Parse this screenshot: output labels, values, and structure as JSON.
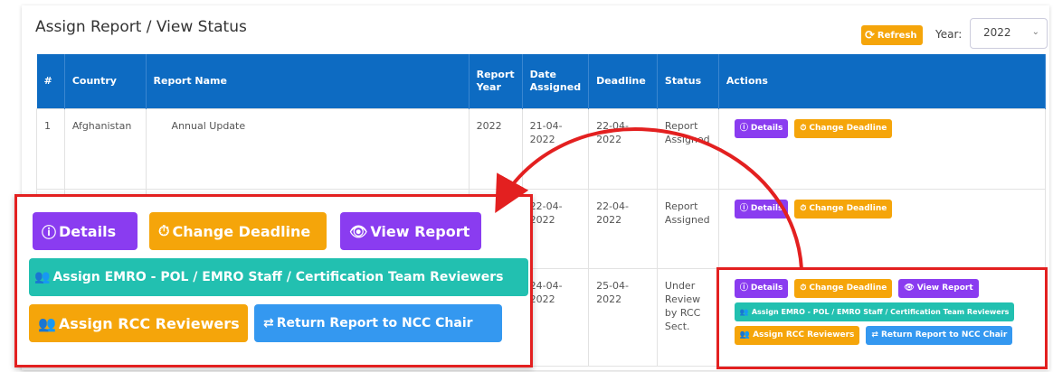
{
  "page": {
    "title": "Assign Report / View Status"
  },
  "toolbar": {
    "refresh_label": "Refresh",
    "year_label": "Year:",
    "year_value": "2022"
  },
  "table": {
    "headers": {
      "num": "#",
      "country": "Country",
      "report_name": "Report Name",
      "report_year": "Report Year",
      "date_assigned": "Date Assigned",
      "deadline": "Deadline",
      "status": "Status",
      "actions": "Actions"
    },
    "rows": [
      {
        "num": "1",
        "country": "Afghanistan",
        "report_name": "Annual Update",
        "report_year": "2022",
        "date_assigned": "21-04-2022",
        "deadline": "22-04-2022",
        "status": "Report Assigned"
      },
      {
        "date_assigned": "22-04-2022",
        "deadline": "22-04-2022",
        "status": "Report Assigned"
      },
      {
        "date_assigned": "24-04-2022",
        "deadline": "25-04-2022",
        "status": "Under Review by RCC Sect."
      }
    ]
  },
  "actions": {
    "details": "Details",
    "change_deadline": "Change Deadline",
    "view_report": "View Report",
    "assign_emro": "Assign EMRO - POL / EMRO Staff / Certification Team Reviewers",
    "assign_rcc": "Assign RCC Reviewers",
    "return_report": "Return Report to NCC Chair"
  },
  "colors": {
    "header_blue": "#0d6bc2",
    "purple": "#8a3cf0",
    "orange": "#f5a50a",
    "teal": "#22c0b0",
    "blue": "#3498f0",
    "highlight_red": "#e32020"
  }
}
